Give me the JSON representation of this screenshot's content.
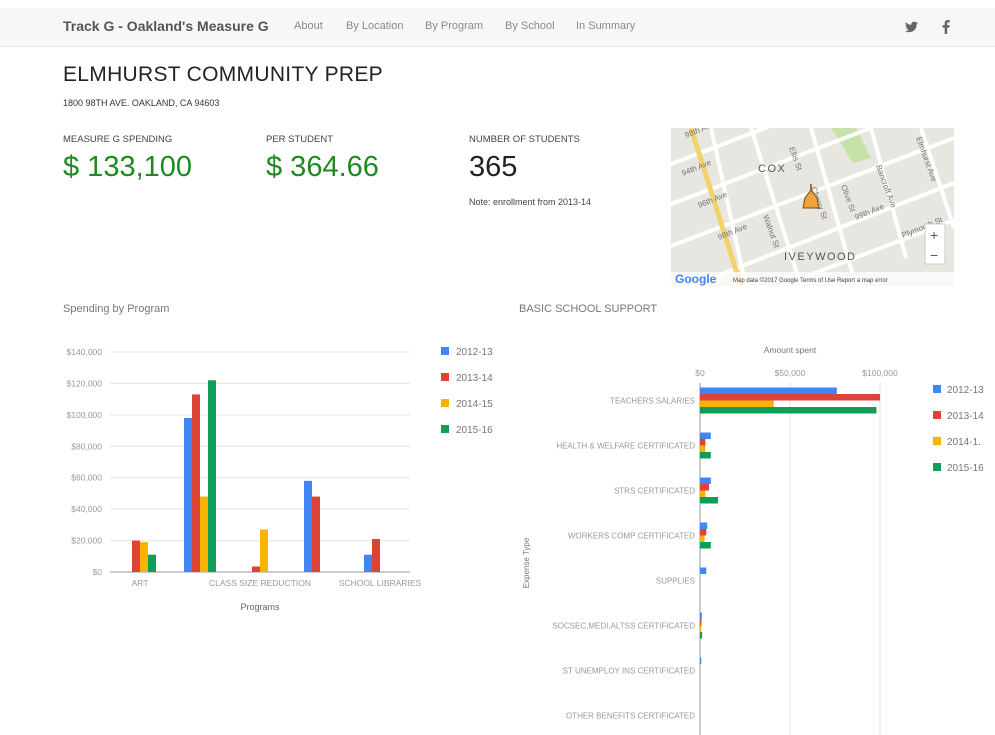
{
  "nav": {
    "brand": "Track G - Oakland's Measure G",
    "links": [
      "About",
      "By Location",
      "By Program",
      "By School",
      "In Summary"
    ],
    "twitter_glyph": "𝕪",
    "facebook_glyph": "f"
  },
  "school": {
    "name": "ELMHURST COMMUNITY PREP",
    "address": "1800 98TH AVE. OAKLAND, CA 94603"
  },
  "stats": {
    "spending_label": "MEASURE G SPENDING",
    "spending_value": "$ 133,100",
    "per_student_label": "PER STUDENT",
    "per_student_value": "$ 364.66",
    "students_label": "NUMBER OF STUDENTS",
    "students_value": "365",
    "note": "Note: enrollment from 2013-14"
  },
  "map": {
    "labels": [
      "COX",
      "IVEYWOOD",
      "98th Ave",
      "96th Ave",
      "99th Ave",
      "94th Ave",
      "Walnut St",
      "Olive St",
      "Bancroft Ave",
      "Elmhurst Ave",
      "Cherry St",
      "Plymouth St",
      "98th Ave",
      "Ellis St"
    ],
    "google": "Google",
    "footer": "Map data ©2017 Google    Terms of Use    Report a map error",
    "zoom_in": "+",
    "zoom_out": "−"
  },
  "colors": {
    "s1": "#4285f4",
    "s2": "#db4437",
    "s3": "#f4b400",
    "s4": "#0f9d58",
    "green_text": "#1f8a1f"
  },
  "chart_data": [
    {
      "type": "bar",
      "title": "Spending by Program",
      "xlabel": "Programs",
      "ylabel": "",
      "ylim": [
        0,
        140000
      ],
      "yticks": [
        "$0",
        "$20,000",
        "$40,000",
        "$60,000",
        "$80,000",
        "$100,000",
        "$120,000",
        "$140,000"
      ],
      "categories": [
        "ART",
        "",
        "CLASS SIZE REDUCTION",
        "",
        "SCHOOL LIBRARIES"
      ],
      "series": [
        {
          "name": "2012-13",
          "values": [
            0,
            98000,
            0,
            58000,
            11000
          ]
        },
        {
          "name": "2013-14",
          "values": [
            20000,
            113000,
            3500,
            48000,
            21000
          ]
        },
        {
          "name": "2014-15",
          "values": [
            19000,
            48000,
            27000,
            0,
            0
          ]
        },
        {
          "name": "2015-16",
          "values": [
            11000,
            122000,
            0,
            0,
            0
          ]
        }
      ],
      "legend": "right",
      "grid": true
    },
    {
      "type": "bar",
      "orientation": "horizontal",
      "title": "BASIC SCHOOL SUPPORT",
      "xlabel": "Amount spent",
      "ylabel": "Expense Type",
      "xlim": [
        0,
        100000
      ],
      "xticks": [
        "$0",
        "$50,000",
        "$100,000"
      ],
      "categories": [
        "TEACHERS SALARIES",
        "HEALTH & WELFARE CERTIFICATED",
        "STRS CERTIFICATED",
        "WORKERS COMP CERTIFICATED",
        "SUPPLIES",
        "SOCSEC,MEDI,ALTSS CERTIFICATED",
        "ST UNEMPLOY INS CERTIFICATED",
        "OTHER BENEFITS CERTIFICATED"
      ],
      "series": [
        {
          "name": "2012-13",
          "values": [
            76000,
            6000,
            6000,
            4000,
            3500,
            1000,
            700,
            0
          ]
        },
        {
          "name": "2013-14",
          "values": [
            100000,
            3000,
            5000,
            3500,
            0,
            800,
            0,
            0
          ]
        },
        {
          "name": "2014-15",
          "values": [
            41000,
            3000,
            3000,
            2500,
            0,
            700,
            0,
            0
          ]
        },
        {
          "name": "2015-16",
          "values": [
            98000,
            6000,
            10000,
            6000,
            0,
            1200,
            0,
            0
          ]
        }
      ],
      "legend_labels": [
        "2012-13",
        "2013-14",
        "2014-1.",
        "2015-16"
      ],
      "legend": "right",
      "grid": true
    }
  ]
}
